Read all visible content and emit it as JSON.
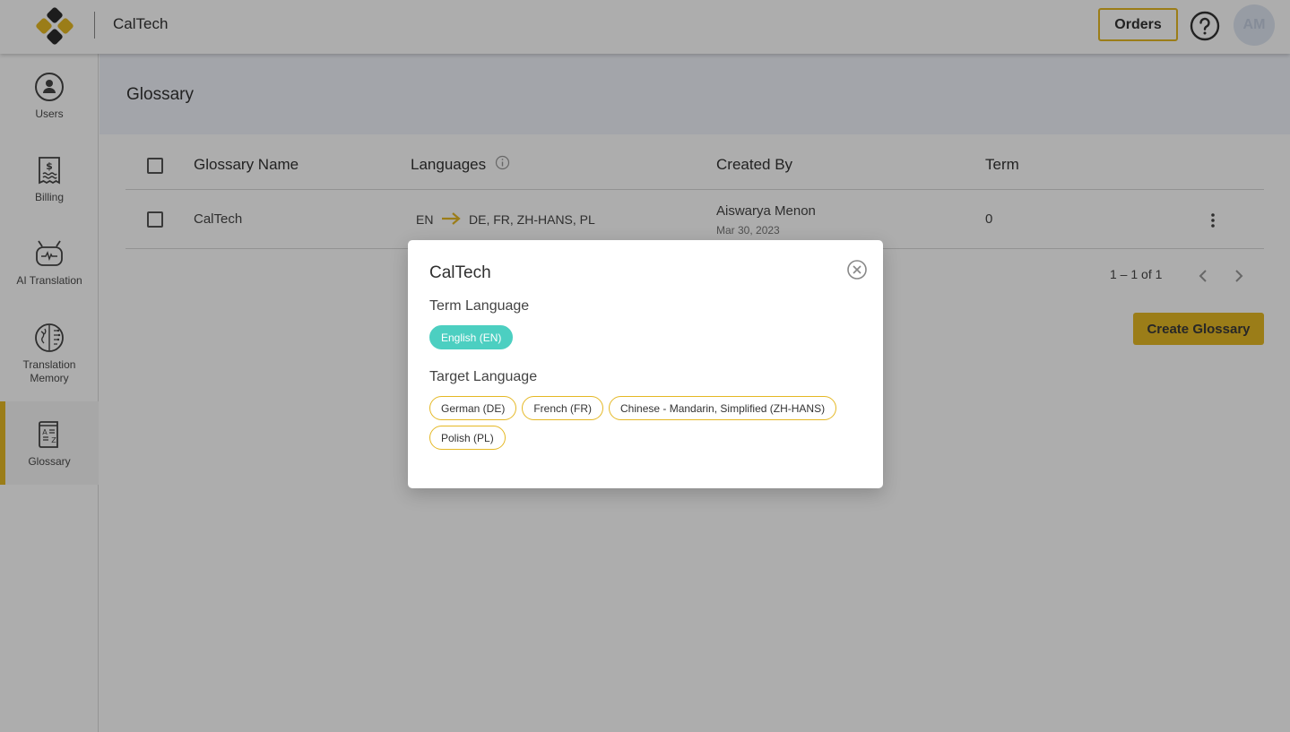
{
  "header": {
    "app_title": "CalTech",
    "orders_label": "Orders",
    "avatar_initials": "AM"
  },
  "sidebar": {
    "items": [
      {
        "label": "Users",
        "icon": "user-circle-icon"
      },
      {
        "label": "Billing",
        "icon": "receipt-dollar-icon"
      },
      {
        "label": "AI Translation",
        "icon": "robot-icon"
      },
      {
        "label": "Translation Memory",
        "icon": "brain-icon"
      },
      {
        "label": "Glossary",
        "icon": "glossary-book-icon",
        "active": true
      }
    ]
  },
  "page": {
    "title": "Glossary"
  },
  "table": {
    "columns": [
      "Glossary Name",
      "Languages",
      "Created By",
      "Term"
    ],
    "rows": [
      {
        "name": "CalTech",
        "source_lang": "EN",
        "target_langs": "DE, FR, ZH-HANS, PL",
        "created_by": "Aiswarya Menon",
        "created_date": "Mar 30, 2023",
        "term": "0"
      }
    ]
  },
  "pagination": {
    "text": "1 – 1 of 1"
  },
  "create_button_label": "Create Glossary",
  "modal": {
    "title": "CalTech",
    "term_language_label": "Term Language",
    "term_languages": [
      "English (EN)"
    ],
    "target_language_label": "Target Language",
    "target_languages": [
      "German (DE)",
      "French (FR)",
      "Chinese - Mandarin, Simplified (ZH-HANS)",
      "Polish (PL)"
    ]
  },
  "colors": {
    "accent": "#e5b824",
    "teal": "#4ccfc1"
  }
}
